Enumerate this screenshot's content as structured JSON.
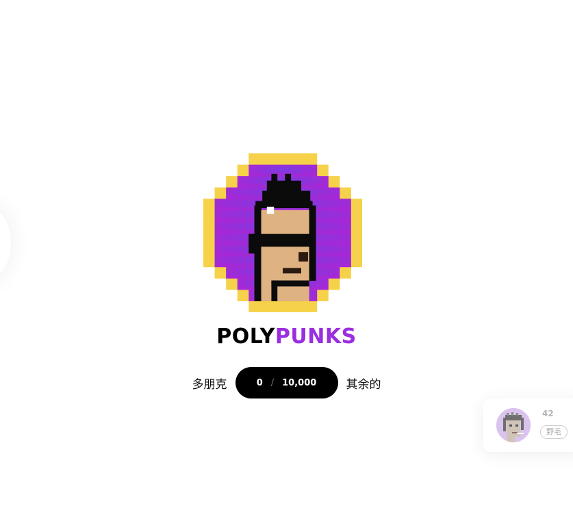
{
  "brand": {
    "word1": "POLY",
    "word2": "PUNKS",
    "logo_icon": "pixel-punk-coin-icon"
  },
  "counter": {
    "left_label": "多朋克",
    "minted": "0",
    "separator": "/",
    "total": "10,000",
    "right_label": "其余的"
  },
  "toast": {
    "avatar_icon": "punk-avatar-icon",
    "count": "42",
    "tag": "野毛"
  },
  "colors": {
    "brand_purple": "#9b2ee0",
    "coin_gold": "#f6d24a",
    "skin": "#dfb282",
    "pill_bg": "#000000"
  }
}
